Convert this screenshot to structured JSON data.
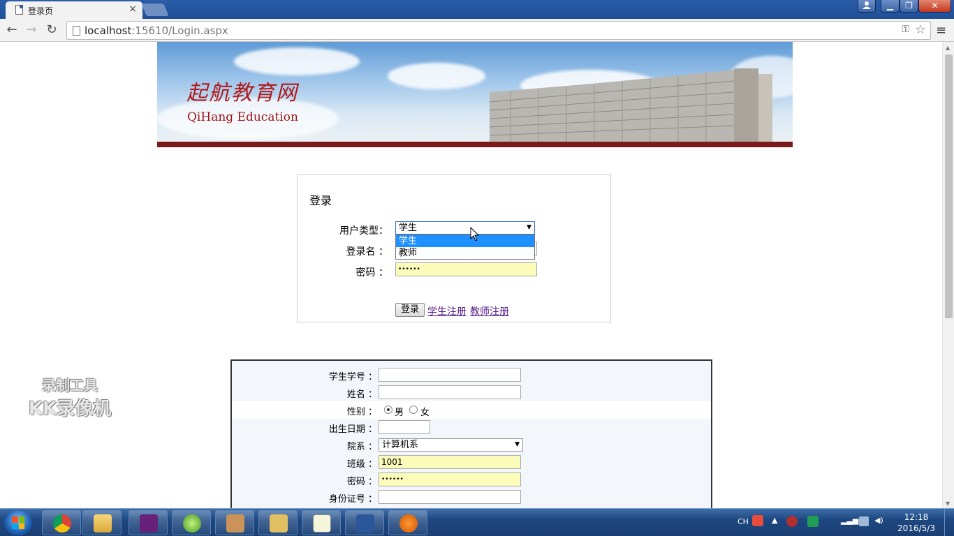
{
  "browser": {
    "tab_title": "登录页",
    "tab_close": "×",
    "url_host": "localhost",
    "url_rest": ":15610/Login.aspx",
    "window_buttons": {
      "minimize": "▁",
      "maximize": "❐",
      "close": "✕"
    }
  },
  "banner": {
    "logo_cn": "起航教育网",
    "logo_en": "QiHang Education"
  },
  "login": {
    "title": "登录",
    "user_type_label": "用户类型：",
    "user_type_value": "学生",
    "user_type_options": [
      "学生",
      "教师"
    ],
    "login_name_label": "登录名 ：",
    "password_label": "密码 ：",
    "password_value": "••••••",
    "login_button": "登录",
    "student_register_link": "学生注册",
    "teacher_register_link": "教师注册"
  },
  "register": {
    "student_id_label": "学生学号 ：",
    "name_label": "姓名 ：",
    "gender_label": "性别 ：",
    "gender_options": [
      "男",
      "女"
    ],
    "gender_selected": "男",
    "birthdate_label": "出生日期 ：",
    "department_label": "院系 ：",
    "department_value": "计算机系",
    "class_label": "班级 ：",
    "class_value": "1001",
    "password_label": "密码 ：",
    "password_value": "••••••",
    "id_card_label": "身份证号 ："
  },
  "watermark": {
    "line1": "录制工具",
    "line2": "KK录像机"
  },
  "taskbar": {
    "tray_lang": "CH",
    "time": "12:18",
    "date": "2016/5/3"
  },
  "colors": {
    "title_bar": "#2a5ca8",
    "banner_bar": "#7a1a1a",
    "logo_red": "#b01818",
    "link_visited": "#551a8b",
    "autofill_yellow": "#fbfcb9",
    "dropdown_highlight": "#1e90ff"
  }
}
